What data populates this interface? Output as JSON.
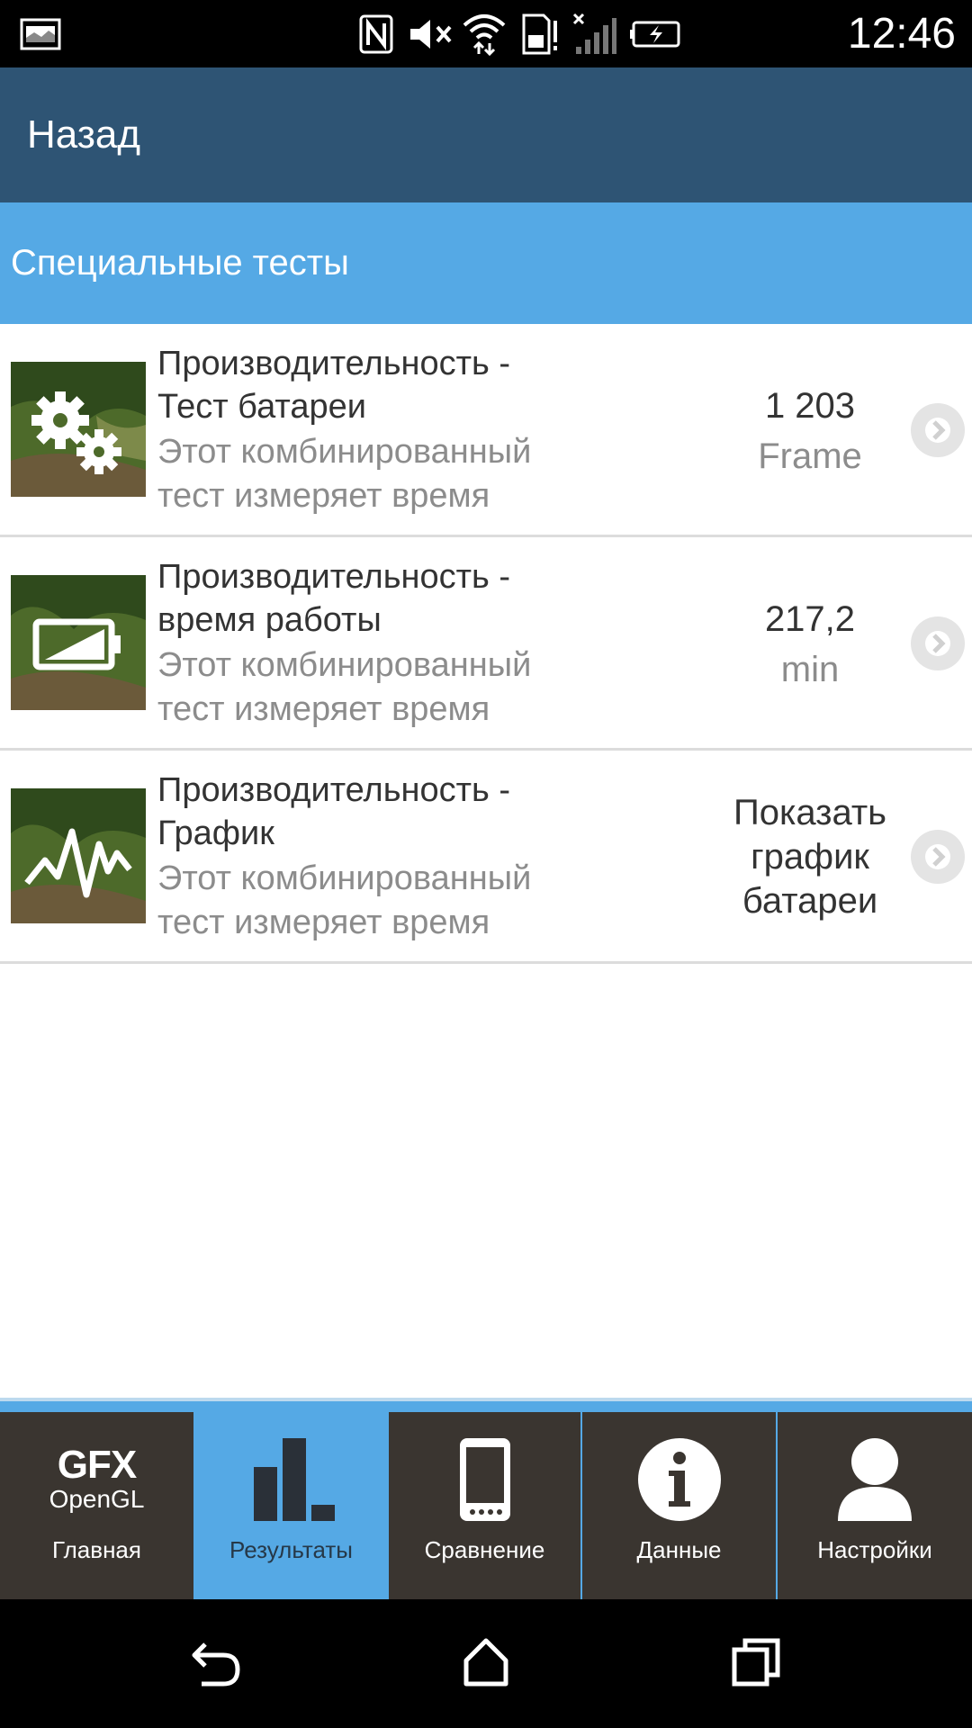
{
  "status_bar": {
    "time": "12:46",
    "icons": [
      "screenshot-icon",
      "nfc-icon",
      "mute-icon",
      "wifi-icon",
      "sd-card-icon",
      "signal-icon",
      "battery-charging-icon"
    ]
  },
  "header": {
    "back_label": "Назад"
  },
  "section": {
    "title": "Специальные тесты"
  },
  "tests": [
    {
      "title_line1": "Производительность -",
      "title_line2": "Тест батареи",
      "desc_line1": "Этот комбинированный",
      "desc_line2": "тест измеряет время",
      "value": "1 203",
      "unit": "Frame",
      "thumb_icon": "gears-icon"
    },
    {
      "title_line1": "Производительность -",
      "title_line2": "время работы",
      "desc_line1": "Этот комбинированный",
      "desc_line2": "тест измеряет время",
      "value": "217,2",
      "unit": "min",
      "thumb_icon": "battery-icon"
    },
    {
      "title_line1": "Производительность -",
      "title_line2": "График",
      "desc_line1": "Этот комбинированный",
      "desc_line2": "тест измеряет время",
      "action_line1": "Показать",
      "action_line2": "график",
      "action_line3": "батареи",
      "thumb_icon": "pulse-graph-icon"
    }
  ],
  "tabs": [
    {
      "label": "Главная",
      "logo_top": "GFX",
      "logo_bottom": "OpenGL",
      "icon": "gfx-logo-icon"
    },
    {
      "label": "Результаты",
      "icon": "bar-chart-icon",
      "active": true
    },
    {
      "label": "Сравнение",
      "icon": "phone-icon"
    },
    {
      "label": "Данные",
      "icon": "info-icon"
    },
    {
      "label": "Настройки",
      "icon": "user-icon"
    }
  ],
  "nav": [
    "back-icon",
    "home-icon",
    "recents-icon"
  ],
  "colors": {
    "header_bg": "#2e5474",
    "section_bg": "#55a9e5",
    "tab_bg": "#3a3530",
    "tab_active_bg": "#55a9e5"
  }
}
